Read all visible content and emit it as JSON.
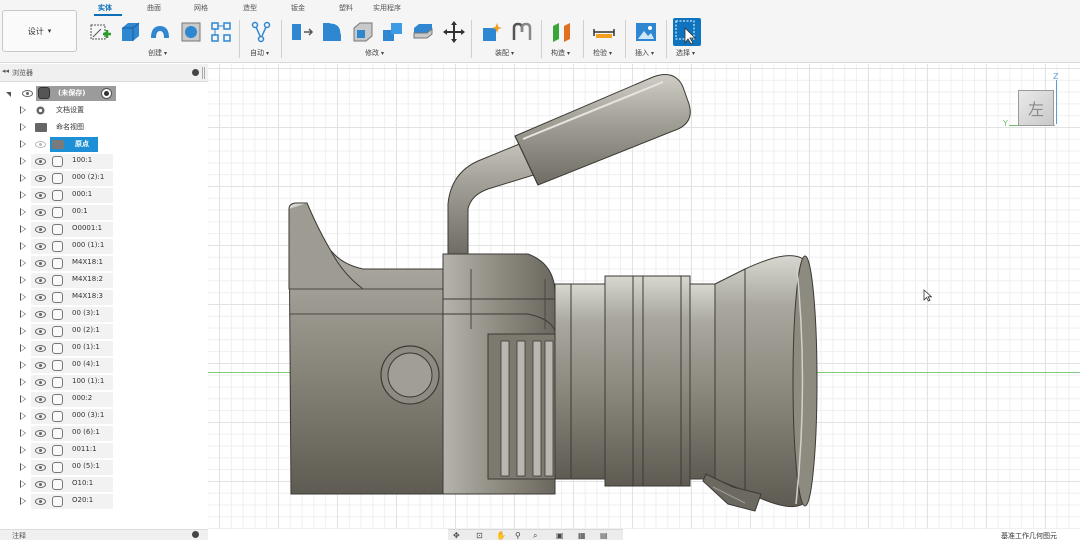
{
  "toolbar": {
    "design_menu": "设计",
    "tabs": [
      {
        "label": "实体",
        "active": true
      },
      {
        "label": "曲面",
        "active": false
      },
      {
        "label": "网格",
        "active": false
      },
      {
        "label": "造型",
        "active": false
      },
      {
        "label": "钣金",
        "active": false
      },
      {
        "label": "塑料",
        "active": false
      },
      {
        "label": "实用程序",
        "active": false
      }
    ],
    "groups": {
      "create": "创建",
      "automate": "自动",
      "modify": "修改",
      "assemble": "装配",
      "construct": "构造",
      "inspect": "检验",
      "insert": "插入",
      "select": "选择"
    },
    "accent_color": "#0c6fb8"
  },
  "browser": {
    "title": "浏览器",
    "root_label": "(未保存)",
    "document_settings": "文档设置",
    "named_views": "命名视图",
    "origin": "原点",
    "components": [
      "100:1",
      "000 (2):1",
      "000:1",
      "00:1",
      "O0001:1",
      "000 (1):1",
      "M4X18:1",
      "M4X18:2",
      "M4X18:3",
      "00 (3):1",
      "00 (2):1",
      "00 (1):1",
      "00 (4):1",
      "100 (1):1",
      "000:2",
      "000 (3):1",
      "00 (6):1",
      "0011:1",
      "00 (5):1",
      "O10:1",
      "O20:1"
    ]
  },
  "comments": {
    "title": "注释"
  },
  "viewcube": {
    "face": "左",
    "z": "Z",
    "y": "Y"
  },
  "status": {
    "text": "基准工作几何图元"
  }
}
